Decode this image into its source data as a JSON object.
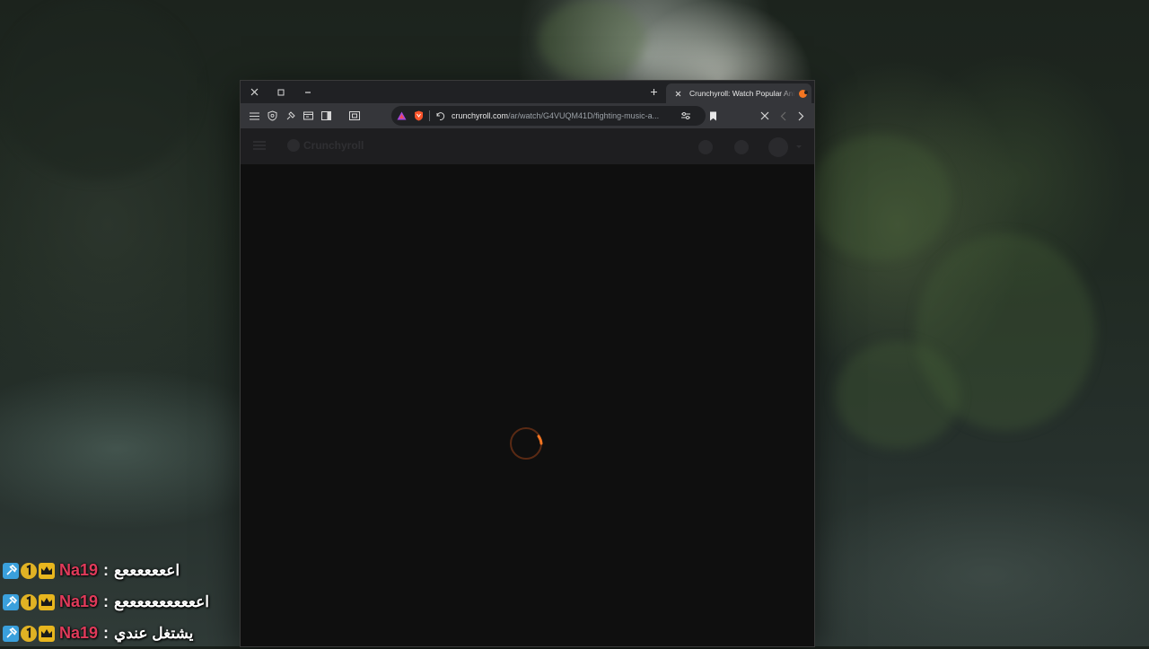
{
  "browser": {
    "tab": {
      "title": "Crunchyroll: Watch Popular Anime",
      "favicon": "crunchyroll-favicon"
    },
    "address_bar": {
      "domain": "crunchyroll.com",
      "path": "/ar/watch/G4VUQM41D/fighting-music-a..."
    },
    "icons": {
      "menu": "menu-icon",
      "shield": "shield-icon",
      "extensions": "puzzle-icon",
      "tab_manager": "tabs-icon",
      "sidebar": "sidebar-icon",
      "screenshot": "screenshot-icon",
      "brave_rewards": "brave-rewards-icon",
      "brave_shields": "brave-shields-icon",
      "history": "history-icon",
      "tune": "site-settings-icon",
      "bookmark": "bookmark-icon",
      "stop": "stop-icon",
      "back": "back-icon",
      "forward": "forward-icon"
    }
  },
  "page": {
    "site_logo_text": "Crunchyroll",
    "state": "loading"
  },
  "chat": {
    "messages": [
      {
        "user": "Na19",
        "separator": ":",
        "text": "اعععععععع"
      },
      {
        "user": "Na19",
        "separator": ":",
        "text": "اعععععععععععع"
      },
      {
        "user": "Na19",
        "separator": ":",
        "text": "يشتغل عندي"
      }
    ]
  },
  "colors": {
    "accent": "#f47521",
    "chat_username": "#e03a5a",
    "browser_toolbar": "#35363a",
    "browser_titlebar": "#202124"
  }
}
